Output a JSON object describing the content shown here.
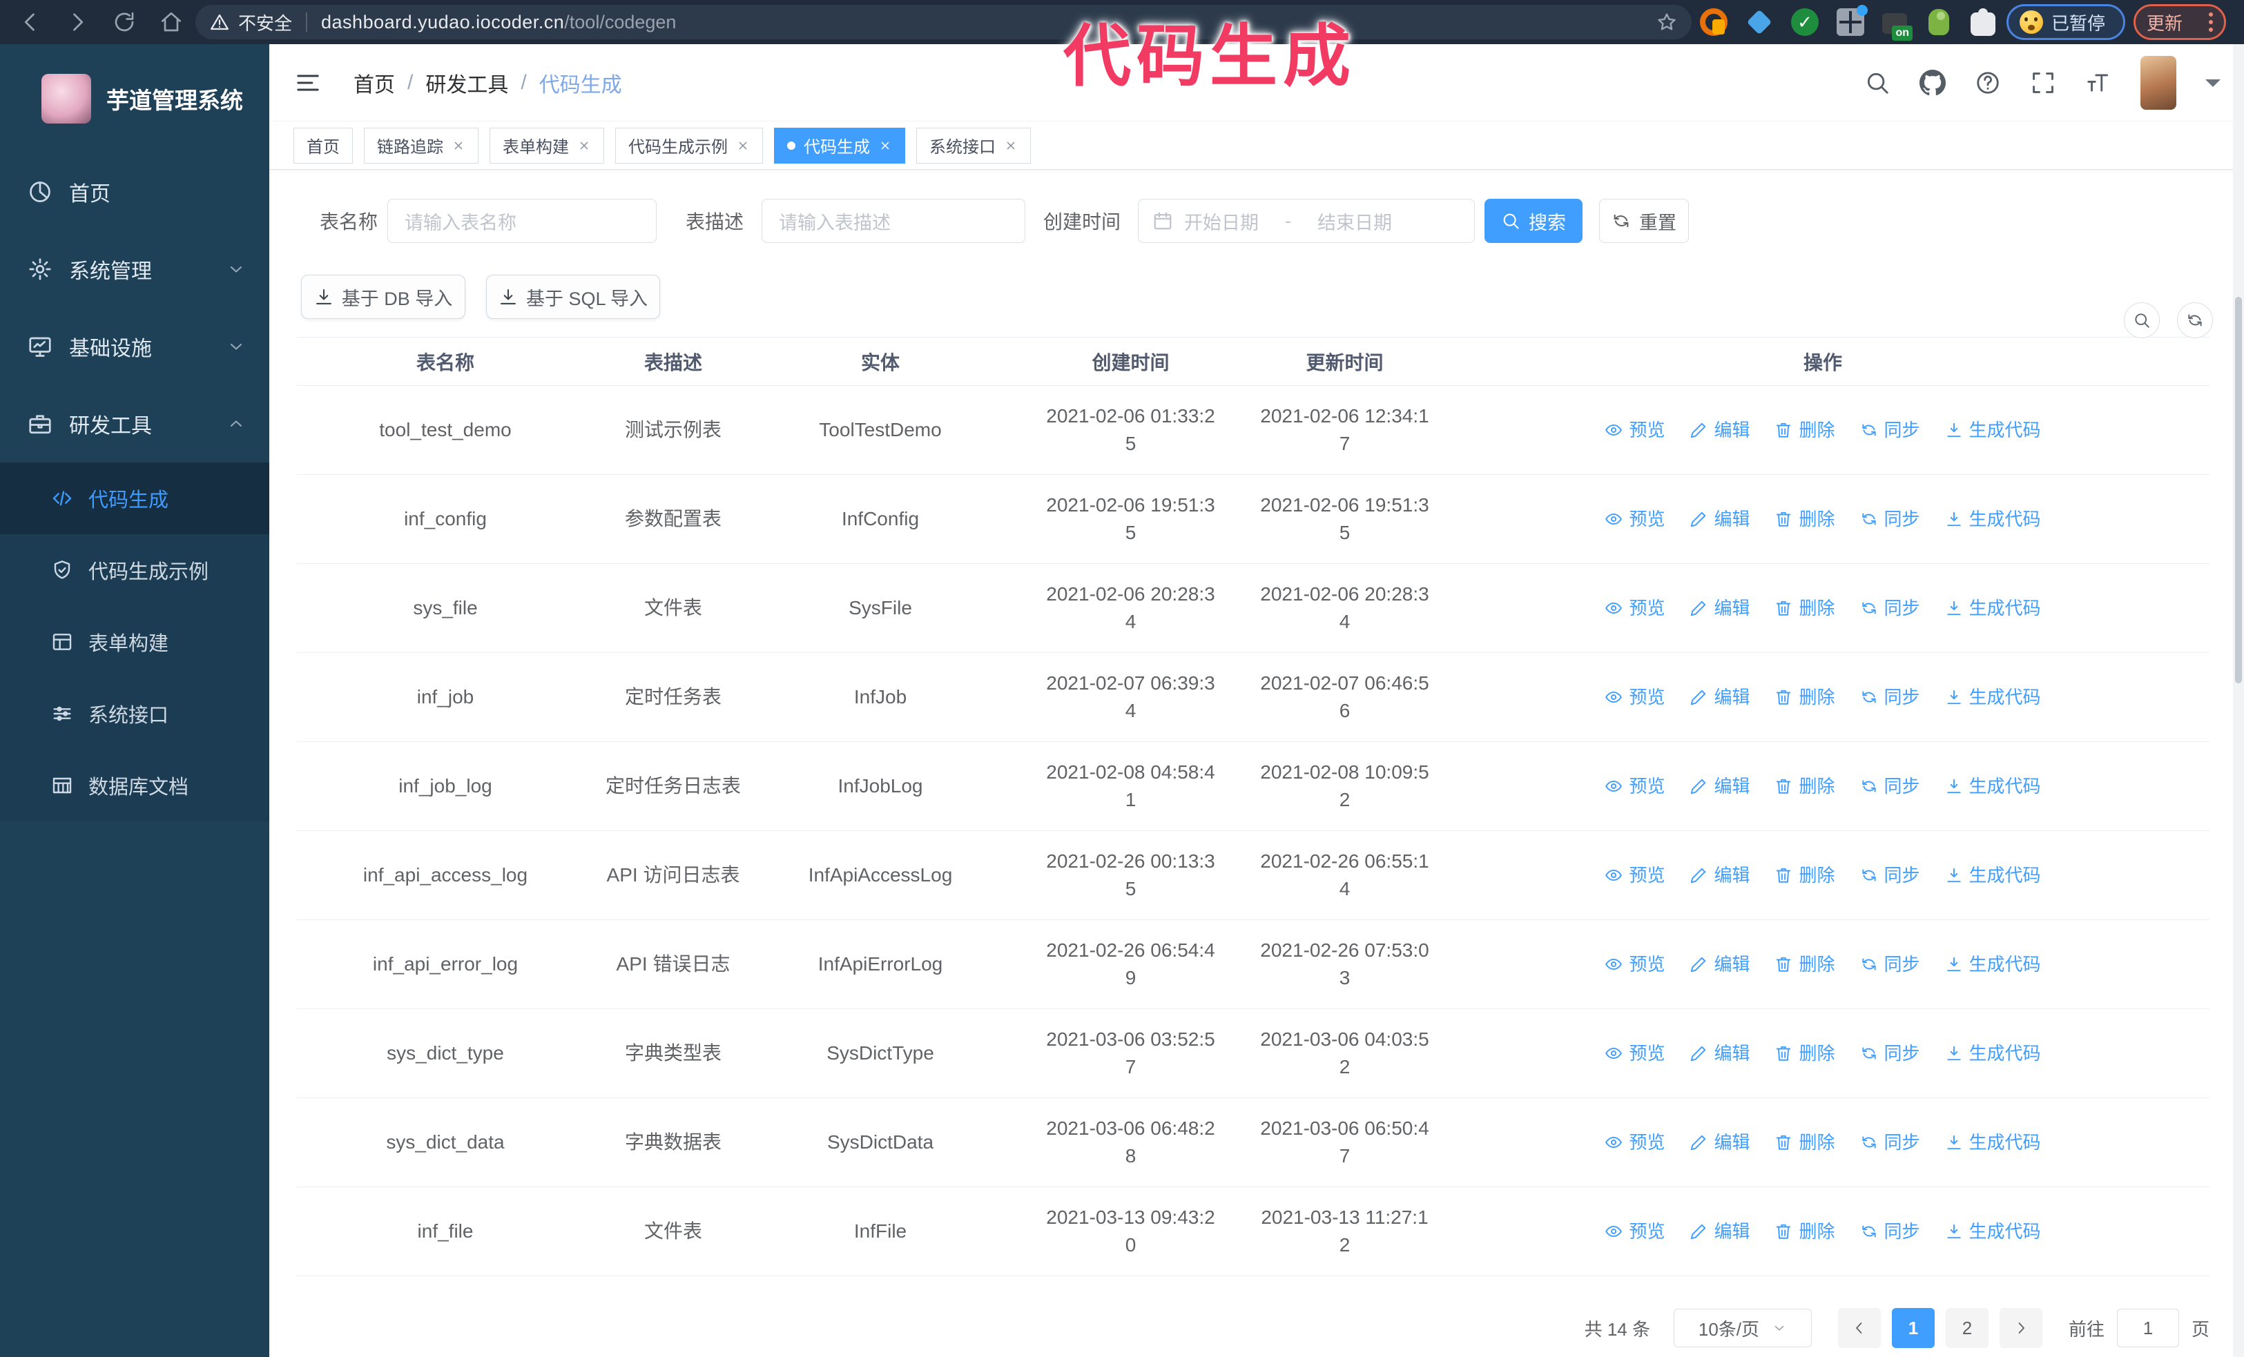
{
  "browser": {
    "security_label": "不安全",
    "url_host": "dashboard.yudao.iocoder.cn",
    "url_path": "/tool/codegen",
    "paused_button": "已暂停",
    "update_button": "更新"
  },
  "annotation": {
    "text": "代码生成",
    "color": "#f23b63"
  },
  "sidebar": {
    "logo_title": "芋道管理系统",
    "items": [
      {
        "label": "首页",
        "icon": "dashboard-icon",
        "expandable": false
      },
      {
        "label": "系统管理",
        "icon": "gear-icon",
        "expandable": true,
        "state": "collapsed"
      },
      {
        "label": "基础设施",
        "icon": "monitor-icon",
        "expandable": true,
        "state": "collapsed"
      },
      {
        "label": "研发工具",
        "icon": "toolbox-icon",
        "expandable": true,
        "state": "expanded"
      }
    ],
    "submenu": [
      {
        "label": "代码生成",
        "icon": "code-icon",
        "active": true
      },
      {
        "label": "代码生成示例",
        "icon": "shield-check-icon",
        "active": false
      },
      {
        "label": "表单构建",
        "icon": "form-icon",
        "active": false
      },
      {
        "label": "系统接口",
        "icon": "sliders-icon",
        "active": false
      },
      {
        "label": "数据库文档",
        "icon": "database-doc-icon",
        "active": false
      }
    ]
  },
  "breadcrumb": [
    "首页",
    "研发工具",
    "代码生成"
  ],
  "breadcrumb_separator": "/",
  "tags": [
    {
      "label": "首页",
      "closable": false,
      "active": false
    },
    {
      "label": "链路追踪",
      "closable": true,
      "active": false
    },
    {
      "label": "表单构建",
      "closable": true,
      "active": false
    },
    {
      "label": "代码生成示例",
      "closable": true,
      "active": false
    },
    {
      "label": "代码生成",
      "closable": true,
      "active": true
    },
    {
      "label": "系统接口",
      "closable": true,
      "active": false
    }
  ],
  "search_form": {
    "table_name_label": "表名称",
    "table_name_placeholder": "请输入表名称",
    "table_desc_label": "表描述",
    "table_desc_placeholder": "请输入表描述",
    "create_time_label": "创建时间",
    "date_start_placeholder": "开始日期",
    "date_separator": "-",
    "date_end_placeholder": "结束日期",
    "search_button": "搜索",
    "reset_button": "重置"
  },
  "toolbar": {
    "import_db_button": "基于 DB 导入",
    "import_sql_button": "基于 SQL 导入"
  },
  "table": {
    "columns": [
      "表名称",
      "表描述",
      "实体",
      "创建时间",
      "更新时间",
      "操作"
    ],
    "actions": [
      {
        "label": "预览",
        "icon": "eye-icon"
      },
      {
        "label": "编辑",
        "icon": "edit-icon"
      },
      {
        "label": "删除",
        "icon": "delete-icon"
      },
      {
        "label": "同步",
        "icon": "sync-icon"
      },
      {
        "label": "生成代码",
        "icon": "download-icon"
      }
    ],
    "rows": [
      {
        "name": "tool_test_demo",
        "desc": "测试示例表",
        "entity": "ToolTestDemo",
        "created": "2021-02-06 01:33:25",
        "updated": "2021-02-06 12:34:17"
      },
      {
        "name": "inf_config",
        "desc": "参数配置表",
        "entity": "InfConfig",
        "created": "2021-02-06 19:51:35",
        "updated": "2021-02-06 19:51:35"
      },
      {
        "name": "sys_file",
        "desc": "文件表",
        "entity": "SysFile",
        "created": "2021-02-06 20:28:34",
        "updated": "2021-02-06 20:28:34"
      },
      {
        "name": "inf_job",
        "desc": "定时任务表",
        "entity": "InfJob",
        "created": "2021-02-07 06:39:34",
        "updated": "2021-02-07 06:46:56"
      },
      {
        "name": "inf_job_log",
        "desc": "定时任务日志表",
        "entity": "InfJobLog",
        "created": "2021-02-08 04:58:41",
        "updated": "2021-02-08 10:09:52"
      },
      {
        "name": "inf_api_access_log",
        "desc": "API 访问日志表",
        "entity": "InfApiAccessLog",
        "created": "2021-02-26 00:13:35",
        "updated": "2021-02-26 06:55:14"
      },
      {
        "name": "inf_api_error_log",
        "desc": "API 错误日志",
        "entity": "InfApiErrorLog",
        "created": "2021-02-26 06:54:49",
        "updated": "2021-02-26 07:53:03"
      },
      {
        "name": "sys_dict_type",
        "desc": "字典类型表",
        "entity": "SysDictType",
        "created": "2021-03-06 03:52:57",
        "updated": "2021-03-06 04:03:52"
      },
      {
        "name": "sys_dict_data",
        "desc": "字典数据表",
        "entity": "SysDictData",
        "created": "2021-03-06 06:48:28",
        "updated": "2021-03-06 06:50:47"
      },
      {
        "name": "inf_file",
        "desc": "文件表",
        "entity": "InfFile",
        "created": "2021-03-13 09:43:20",
        "updated": "2021-03-13 11:27:12"
      }
    ]
  },
  "pagination": {
    "total_label": "共 14 条",
    "page_size": "10条/页",
    "pages": [
      "1",
      "2"
    ],
    "current_page": "1",
    "goto_label": "前往",
    "goto_value": "1",
    "page_suffix": "页"
  },
  "colors": {
    "accent": "#409eff",
    "sidebar_bg": "#1f4158",
    "annotation": "#f23b63",
    "browser_bar": "#202c3b"
  }
}
